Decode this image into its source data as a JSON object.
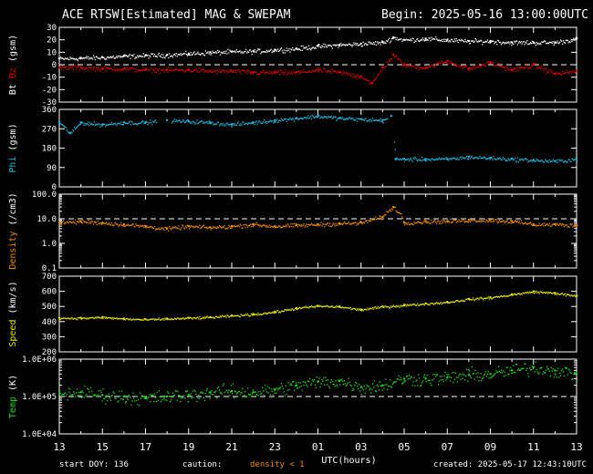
{
  "header": {
    "title": "ACE RTSW[Estimated] MAG & SWEPAM",
    "begin": "Begin: 2025-05-16 13:00:00UTC"
  },
  "footer": {
    "start_doy": "start DOY: 136",
    "caution": "caution:",
    "density_note": "density < 1",
    "created": "created: 2025-05-17 12:43:10UTC"
  },
  "colors": {
    "background": "#000000",
    "frame": "#ffffff",
    "bt": "#ffffff",
    "bz": "#dd0000",
    "phi": "#22b8e0",
    "density": "#f08c00",
    "speed": "#e6e600",
    "temp": "#22dd22"
  },
  "chart_data": {
    "type": "scatter",
    "x": {
      "label": "UTC(hours)",
      "ticks": [
        "13",
        "15",
        "17",
        "19",
        "21",
        "23",
        "01",
        "03",
        "05",
        "07",
        "09",
        "11",
        "13"
      ],
      "range_hours": [
        0,
        24
      ]
    },
    "panels": [
      {
        "id": "mag",
        "ylabel_parts": [
          {
            "text": "Bt",
            "color": "#ffffff"
          },
          {
            "text": "Bz",
            "color": "#dd0000"
          },
          {
            "text": "(gsm)",
            "color": "#ffffff"
          }
        ],
        "ylim": [
          -30,
          30
        ],
        "yticks": [
          "30",
          "20",
          "10",
          "0",
          "-10",
          "-20",
          "-30"
        ],
        "reference_line": 0,
        "series": [
          {
            "name": "Bt",
            "color": "#ffffff",
            "x": [
              0,
              1,
              2,
              3,
              4,
              5,
              6,
              7,
              8,
              9,
              10,
              11,
              12,
              13,
              14,
              15,
              15.5,
              16,
              17,
              18,
              19,
              20,
              21,
              22,
              23,
              24
            ],
            "y": [
              5,
              5.5,
              6,
              7,
              7.5,
              8,
              9,
              10,
              10.5,
              11,
              12,
              13,
              15,
              16,
              17,
              18,
              22,
              20,
              21,
              20,
              19,
              19,
              18,
              18,
              18,
              21
            ]
          },
          {
            "name": "Bz",
            "color": "#dd0000",
            "x": [
              0,
              1,
              2,
              3,
              4,
              5,
              6,
              7,
              8,
              9,
              10,
              11,
              12,
              13,
              14,
              14.5,
              15,
              15.5,
              16,
              17,
              18,
              19,
              20,
              21,
              22,
              23,
              24
            ],
            "y": [
              -2,
              -2,
              -3,
              -3,
              -4,
              -4,
              -4,
              -5,
              -5,
              -6,
              -6,
              -6,
              -4,
              -6,
              -9,
              -15,
              -2,
              8,
              0,
              -2,
              3,
              -3,
              2,
              -4,
              0,
              -7,
              -5
            ]
          }
        ]
      },
      {
        "id": "phi",
        "ylabel_parts": [
          {
            "text": "Phi",
            "color": "#22b8e0"
          },
          {
            "text": "(gsm)",
            "color": "#ffffff"
          }
        ],
        "ylim": [
          0,
          360
        ],
        "yticks": [
          "360",
          "270",
          "180",
          "90",
          "0"
        ],
        "series": [
          {
            "name": "Phi",
            "color": "#22b8e0",
            "x": [
              0,
              0.5,
              1,
              2,
              3,
              4,
              5,
              6,
              7,
              8,
              9,
              10,
              11,
              12,
              13,
              14,
              15,
              15.4,
              15.6,
              16,
              17,
              18,
              19,
              20,
              21,
              22,
              23,
              24
            ],
            "y": [
              300,
              250,
              300,
              290,
              300,
              300,
              310,
              305,
              300,
              290,
              300,
              310,
              320,
              330,
              320,
              315,
              310,
              330,
              130,
              130,
              130,
              130,
              140,
              135,
              130,
              125,
              120,
              130
            ]
          }
        ]
      },
      {
        "id": "density",
        "ylabel_parts": [
          {
            "text": "Density",
            "color": "#f08c00"
          },
          {
            "text": "(/cm3)",
            "color": "#ffffff"
          }
        ],
        "yscale": "log",
        "ylim": [
          0.1,
          100
        ],
        "yticks": [
          "100.0",
          "10.0",
          "1.0",
          "0.1"
        ],
        "reference_line": 10,
        "series": [
          {
            "name": "Density",
            "color": "#f08c00",
            "x": [
              0,
              1,
              2,
              3,
              4,
              5,
              6,
              7,
              8,
              9,
              10,
              11,
              12,
              13,
              14,
              15,
              15.5,
              16,
              17,
              18,
              19,
              20,
              21,
              22,
              23,
              24
            ],
            "y": [
              7,
              8,
              7,
              6,
              5,
              4,
              5,
              4.5,
              5,
              6,
              5,
              5.5,
              6,
              6.5,
              7,
              12,
              30,
              7,
              8,
              8,
              9,
              9,
              8,
              6,
              6,
              5.5
            ]
          }
        ]
      },
      {
        "id": "speed",
        "ylabel_parts": [
          {
            "text": "Speed",
            "color": "#e6e600"
          },
          {
            "text": "(km/s)",
            "color": "#ffffff"
          }
        ],
        "ylim": [
          200,
          700
        ],
        "yticks": [
          "700",
          "600",
          "500",
          "400",
          "300",
          "200"
        ],
        "series": [
          {
            "name": "Speed",
            "color": "#e6e600",
            "x": [
              0,
              1,
              2,
              3,
              4,
              5,
              6,
              7,
              8,
              9,
              10,
              11,
              12,
              13,
              14,
              15,
              16,
              17,
              18,
              19,
              20,
              21,
              22,
              23,
              24
            ],
            "y": [
              425,
              425,
              430,
              420,
              415,
              420,
              425,
              430,
              440,
              450,
              465,
              490,
              505,
              500,
              480,
              500,
              510,
              520,
              530,
              550,
              560,
              580,
              600,
              590,
              570
            ]
          }
        ]
      },
      {
        "id": "temp",
        "ylabel_parts": [
          {
            "text": "Temp",
            "color": "#22dd22"
          },
          {
            "text": "(K)",
            "color": "#ffffff"
          }
        ],
        "yscale": "log",
        "ylim": [
          10000,
          1000000
        ],
        "yticks": [
          "1.0E+06",
          "1.0E+05",
          "1.0E+04"
        ],
        "reference_line": 100000,
        "series": [
          {
            "name": "Temp",
            "color": "#22dd22",
            "x": [
              0,
              1,
              2,
              3,
              4,
              5,
              6,
              7,
              8,
              9,
              10,
              11,
              12,
              13,
              14,
              15,
              16,
              17,
              18,
              19,
              20,
              21,
              22,
              23,
              24
            ],
            "y": [
              120000,
              130000,
              110000,
              100000,
              90000,
              100000,
              110000,
              130000,
              140000,
              130000,
              150000,
              200000,
              250000,
              260000,
              180000,
              200000,
              300000,
              300000,
              320000,
              380000,
              400000,
              500000,
              600000,
              500000,
              400000
            ]
          }
        ]
      }
    ]
  }
}
